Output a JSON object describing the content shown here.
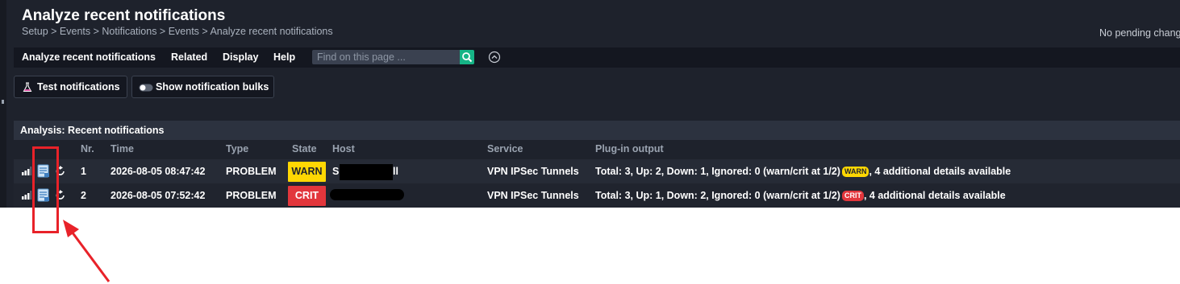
{
  "header": {
    "title": "Analyze recent notifications",
    "breadcrumb": "Setup > Events > Notifications > Events > Analyze recent notifications",
    "pending": "No pending chang"
  },
  "menu": {
    "items": [
      "Analyze recent notifications",
      "Related",
      "Display",
      "Help"
    ],
    "search_placeholder": "Find on this page ..."
  },
  "toolbar": {
    "test_label": "Test notifications",
    "bulks_label": "Show notification bulks"
  },
  "section": {
    "title": "Analysis: Recent notifications"
  },
  "table": {
    "columns": [
      "Nr.",
      "Time",
      "Type",
      "State",
      "Host",
      "Service",
      "Plug-in output"
    ],
    "rows": [
      {
        "nr": "1",
        "time": "2026-08-05 08:47:42",
        "type": "PROBLEM",
        "state": "WARN",
        "host_prefix": "S",
        "host_suffix": "ll",
        "service": "VPN IPSec Tunnels",
        "output_pre": "Total: 3, Up: 2, Down: 1, Ignored: 0 (warn/crit at 1/2)",
        "output_badge": "WARN",
        "output_post": ", 4 additional details available"
      },
      {
        "nr": "2",
        "time": "2026-08-05 07:52:42",
        "type": "PROBLEM",
        "state": "CRIT",
        "host_prefix": "",
        "host_suffix": "",
        "service": "VPN IPSec Tunnels",
        "output_pre": "Total: 3, Up: 1, Down: 2, Ignored: 0 (warn/crit at 1/2)",
        "output_badge": "CRIT",
        "output_post": ", 4 additional details available"
      }
    ]
  },
  "colors": {
    "background": "#1e222c",
    "accent_green": "#16b486",
    "warn": "#ffd703",
    "crit": "#e2363c",
    "annotation": "#e82229"
  },
  "icons": [
    "flask-icon",
    "toggle-icon",
    "search-icon",
    "chevron-up-circle-icon",
    "signal-bars-icon",
    "notification-context-icon",
    "reload-icon",
    "arrow-annotation"
  ]
}
